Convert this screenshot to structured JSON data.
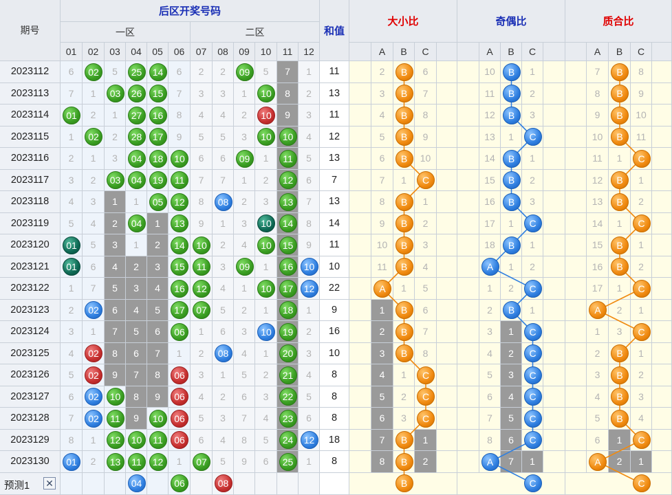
{
  "header": {
    "period_label": "期号",
    "back_title": "后区开奖号码",
    "zone1_label": "一区",
    "zone2_label": "二区",
    "sum_label": "和值",
    "size_ratio_label": "大小比",
    "odd_even_label": "奇偶比",
    "prime_label": "质合比",
    "number_labels": [
      "01",
      "02",
      "03",
      "04",
      "05",
      "06",
      "07",
      "08",
      "09",
      "10",
      "11",
      "12"
    ],
    "abc_labels": [
      "A",
      "B",
      "C"
    ]
  },
  "colors": {
    "green": "#3a9e22",
    "blue": "#2f7fe0",
    "red": "#c62f2f",
    "teal": "#0e6a55",
    "orange": "#f08a10"
  },
  "rows": [
    {
      "period": "2023112",
      "nums": [
        "6",
        "02",
        "5",
        "25",
        "14",
        "6",
        "2",
        "2",
        "09",
        "5",
        "7",
        "1"
      ],
      "sum": "11",
      "size": [
        "2",
        "B",
        "6"
      ],
      "oe": [
        "10",
        "B",
        "1"
      ],
      "pr": [
        "7",
        "B",
        "8"
      ]
    },
    {
      "period": "2023113",
      "nums": [
        "7",
        "1",
        "03",
        "26",
        "15",
        "7",
        "3",
        "3",
        "1",
        "10",
        "8",
        "2"
      ],
      "sum": "13",
      "size": [
        "3",
        "B",
        "7"
      ],
      "oe": [
        "11",
        "B",
        "2"
      ],
      "pr": [
        "8",
        "B",
        "9"
      ]
    },
    {
      "period": "2023114",
      "nums": [
        "01",
        "2",
        "1",
        "27",
        "16",
        "8",
        "4",
        "4",
        "2",
        "10",
        "9",
        "3"
      ],
      "sum": "11",
      "size": [
        "4",
        "B",
        "8"
      ],
      "oe": [
        "12",
        "B",
        "3"
      ],
      "pr": [
        "9",
        "B",
        "10"
      ]
    },
    {
      "period": "2023115",
      "nums": [
        "1",
        "02",
        "2",
        "28",
        "17",
        "9",
        "5",
        "5",
        "3",
        "10",
        "10",
        "4"
      ],
      "sum": "12",
      "size": [
        "5",
        "B",
        "9"
      ],
      "oe": [
        "13",
        "1",
        "C"
      ],
      "pr": [
        "10",
        "B",
        "11"
      ]
    },
    {
      "period": "2023116",
      "nums": [
        "2",
        "1",
        "3",
        "04",
        "18",
        "10",
        "6",
        "6",
        "09",
        "1",
        "11",
        "5"
      ],
      "sum": "13",
      "size": [
        "6",
        "B",
        "10"
      ],
      "oe": [
        "14",
        "B",
        "1"
      ],
      "pr": [
        "11",
        "1",
        "C"
      ]
    },
    {
      "period": "2023117",
      "nums": [
        "3",
        "2",
        "03",
        "04",
        "19",
        "11",
        "7",
        "7",
        "1",
        "2",
        "12",
        "6"
      ],
      "sum": "7",
      "size": [
        "7",
        "1",
        "C"
      ],
      "oe": [
        "15",
        "B",
        "2"
      ],
      "pr": [
        "12",
        "B",
        "1"
      ]
    },
    {
      "period": "2023118",
      "nums": [
        "4",
        "3",
        "1",
        "1",
        "05",
        "12",
        "8",
        "08",
        "2",
        "3",
        "13",
        "7"
      ],
      "sum": "13",
      "size": [
        "8",
        "B",
        "1"
      ],
      "oe": [
        "16",
        "B",
        "3"
      ],
      "pr": [
        "13",
        "B",
        "2"
      ]
    },
    {
      "period": "2023119",
      "nums": [
        "5",
        "4",
        "2",
        "04",
        "1",
        "13",
        "9",
        "1",
        "3",
        "10",
        "14",
        "8"
      ],
      "sum": "14",
      "size": [
        "9",
        "B",
        "2"
      ],
      "oe": [
        "17",
        "1",
        "C"
      ],
      "pr": [
        "14",
        "1",
        "C"
      ]
    },
    {
      "period": "2023120",
      "nums": [
        "01",
        "5",
        "3",
        "1",
        "2",
        "14",
        "10",
        "2",
        "4",
        "10",
        "15",
        "9"
      ],
      "sum": "11",
      "size": [
        "10",
        "B",
        "3"
      ],
      "oe": [
        "18",
        "B",
        "1"
      ],
      "pr": [
        "15",
        "B",
        "1"
      ]
    },
    {
      "period": "2023121",
      "nums": [
        "01",
        "6",
        "4",
        "2",
        "3",
        "15",
        "11",
        "3",
        "09",
        "1",
        "16",
        "10"
      ],
      "sum": "10",
      "size": [
        "11",
        "B",
        "4"
      ],
      "oe": [
        "A",
        "1",
        "2"
      ],
      "pr": [
        "16",
        "B",
        "2"
      ]
    },
    {
      "period": "2023122",
      "nums": [
        "1",
        "7",
        "5",
        "3",
        "4",
        "16",
        "12",
        "4",
        "1",
        "10",
        "17",
        "12"
      ],
      "sum": "22",
      "size": [
        "A",
        "1",
        "5"
      ],
      "oe": [
        "1",
        "2",
        "C"
      ],
      "pr": [
        "17",
        "1",
        "C"
      ]
    },
    {
      "period": "2023123",
      "nums": [
        "2",
        "02",
        "6",
        "4",
        "5",
        "17",
        "07",
        "5",
        "2",
        "1",
        "18",
        "1"
      ],
      "sum": "9",
      "size": [
        "1",
        "B",
        "6"
      ],
      "oe": [
        "2",
        "B",
        "1"
      ],
      "pr": [
        "A",
        "2",
        "1"
      ]
    },
    {
      "period": "2023124",
      "nums": [
        "3",
        "1",
        "7",
        "5",
        "6",
        "06",
        "1",
        "6",
        "3",
        "10",
        "19",
        "2"
      ],
      "sum": "16",
      "size": [
        "2",
        "B",
        "7"
      ],
      "oe": [
        "3",
        "1",
        "C"
      ],
      "pr": [
        "1",
        "3",
        "C"
      ]
    },
    {
      "period": "2023125",
      "nums": [
        "4",
        "02",
        "8",
        "6",
        "7",
        "1",
        "2",
        "08",
        "4",
        "1",
        "20",
        "3"
      ],
      "sum": "10",
      "size": [
        "3",
        "B",
        "8"
      ],
      "oe": [
        "4",
        "2",
        "C"
      ],
      "pr": [
        "2",
        "B",
        "1"
      ]
    },
    {
      "period": "2023126",
      "nums": [
        "5",
        "02",
        "9",
        "7",
        "8",
        "06",
        "3",
        "1",
        "5",
        "2",
        "21",
        "4"
      ],
      "sum": "8",
      "size": [
        "4",
        "1",
        "C"
      ],
      "oe": [
        "5",
        "3",
        "C"
      ],
      "pr": [
        "3",
        "B",
        "2"
      ]
    },
    {
      "period": "2023127",
      "nums": [
        "6",
        "02",
        "10",
        "8",
        "9",
        "06",
        "4",
        "2",
        "6",
        "3",
        "22",
        "5"
      ],
      "sum": "8",
      "size": [
        "5",
        "2",
        "C"
      ],
      "oe": [
        "6",
        "4",
        "C"
      ],
      "pr": [
        "4",
        "B",
        "3"
      ]
    },
    {
      "period": "2023128",
      "nums": [
        "7",
        "02",
        "11",
        "9",
        "10",
        "06",
        "5",
        "3",
        "7",
        "4",
        "23",
        "6"
      ],
      "sum": "8",
      "size": [
        "6",
        "3",
        "C"
      ],
      "oe": [
        "7",
        "5",
        "C"
      ],
      "pr": [
        "5",
        "B",
        "4"
      ]
    },
    {
      "period": "2023129",
      "nums": [
        "8",
        "1",
        "12",
        "10",
        "11",
        "06",
        "6",
        "4",
        "8",
        "5",
        "24",
        "12"
      ],
      "sum": "18",
      "size": [
        "7",
        "B",
        "1"
      ],
      "oe": [
        "8",
        "6",
        "C"
      ],
      "pr": [
        "6",
        "1",
        "C"
      ]
    },
    {
      "period": "2023130",
      "nums": [
        "01",
        "2",
        "13",
        "11",
        "12",
        "1",
        "07",
        "5",
        "9",
        "6",
        "25",
        "1"
      ],
      "sum": "8",
      "size": [
        "8",
        "B",
        "2"
      ],
      "oe": [
        "A",
        "7",
        "1"
      ],
      "pr": [
        "A",
        "2",
        "1"
      ]
    }
  ],
  "predict": {
    "label": "预测1",
    "close_icon": "close-icon",
    "nums": [
      "04",
      "06",
      "08"
    ],
    "size": "B",
    "oe": "C",
    "pr": "C"
  }
}
